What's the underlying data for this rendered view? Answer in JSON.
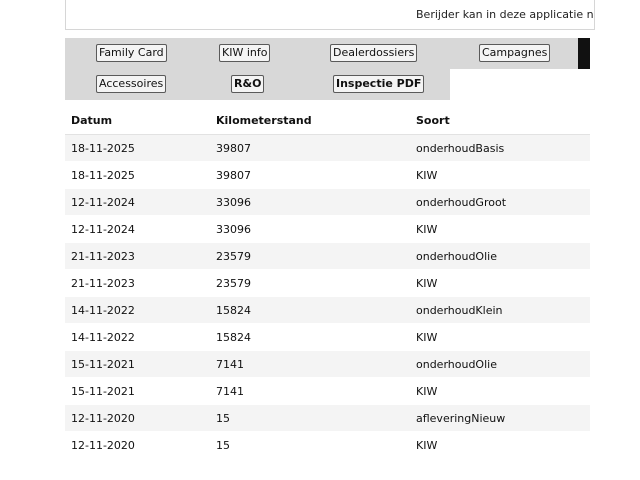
{
  "notice": {
    "text": "Berijder kan in deze applicatie ni"
  },
  "nav": {
    "row1": [
      "Family Card",
      "KIW info",
      "Dealerdossiers",
      "Campagnes"
    ],
    "row2": [
      "Accessoires",
      "R&O",
      "Inspectie PDF"
    ]
  },
  "table": {
    "headers": [
      "Datum",
      "Kilometerstand",
      "Soort"
    ],
    "rows": [
      [
        "18-11-2025",
        "39807",
        "onderhoudBasis"
      ],
      [
        "18-11-2025",
        "39807",
        "KIW"
      ],
      [
        "12-11-2024",
        "33096",
        "onderhoudGroot"
      ],
      [
        "12-11-2024",
        "33096",
        "KIW"
      ],
      [
        "21-11-2023",
        "23579",
        "onderhoudOlie"
      ],
      [
        "21-11-2023",
        "23579",
        "KIW"
      ],
      [
        "14-11-2022",
        "15824",
        "onderhoudKlein"
      ],
      [
        "14-11-2022",
        "15824",
        "KIW"
      ],
      [
        "15-11-2021",
        "7141",
        "onderhoudOlie"
      ],
      [
        "15-11-2021",
        "7141",
        "KIW"
      ],
      [
        "12-11-2020",
        "15",
        "afleveringNieuw"
      ],
      [
        "12-11-2020",
        "15",
        "KIW"
      ]
    ]
  }
}
